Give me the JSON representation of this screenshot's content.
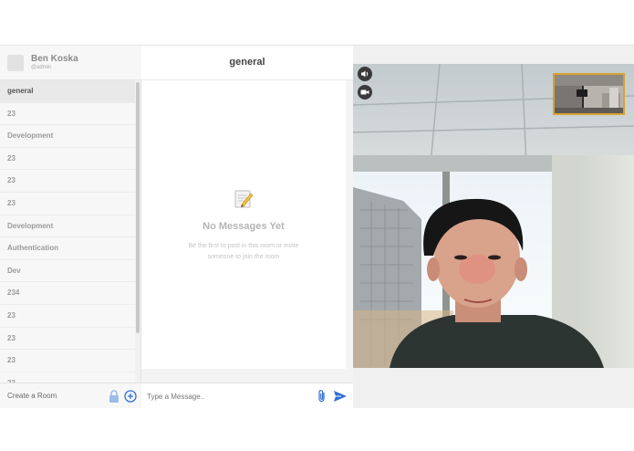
{
  "user": {
    "name": "Ben Koska",
    "handle": "@admin"
  },
  "rooms": [
    {
      "label": "general",
      "active": true
    },
    {
      "label": "23"
    },
    {
      "label": "Development"
    },
    {
      "label": "23"
    },
    {
      "label": "23"
    },
    {
      "label": "23"
    },
    {
      "label": "Development"
    },
    {
      "label": "Authentication"
    },
    {
      "label": "Dev"
    },
    {
      "label": "234"
    },
    {
      "label": "23"
    },
    {
      "label": "23"
    },
    {
      "label": "23"
    },
    {
      "label": "23"
    }
  ],
  "sidebar_footer": {
    "create_label": "Create a Room",
    "lock_icon": "lock-icon",
    "add_icon": "plus-circle-icon"
  },
  "chat": {
    "title": "general",
    "empty_title": "No Messages Yet",
    "empty_subtitle": "Be the first to post in this room or invite someone to join the room",
    "empty_icon": "memo-icon",
    "composer_placeholder": "Type a Message..",
    "attach_icon": "paperclip-icon",
    "send_icon": "send-icon"
  },
  "video": {
    "mute_icon": "speaker-icon",
    "camera_icon": "camera-icon"
  },
  "colors": {
    "accent": "#2f6fd6",
    "active_room_bg": "#e9e9e9",
    "pip_border": "#d7a233"
  }
}
